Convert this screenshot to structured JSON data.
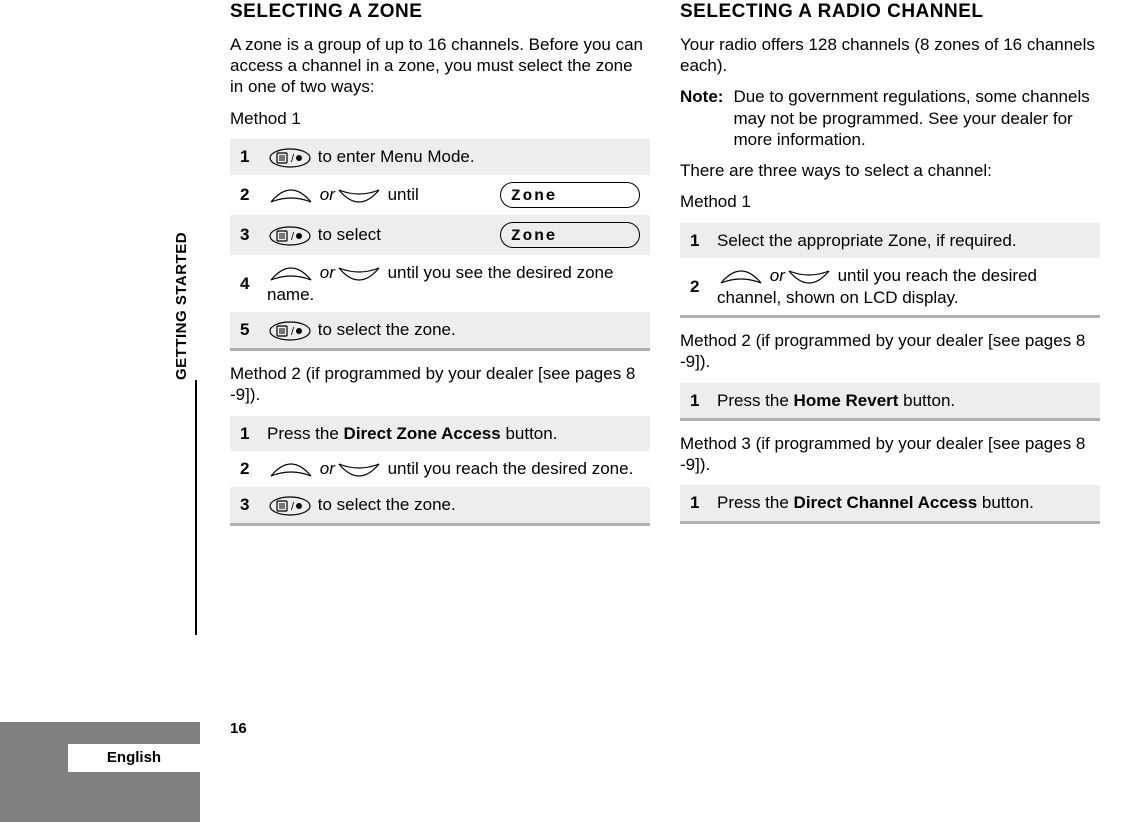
{
  "sidebar": {
    "tab_label": "English",
    "section_label": "GETTING STARTED"
  },
  "page_number": "16",
  "left": {
    "heading": "SELECTING A ZONE",
    "intro": "A zone is a group of up to 16 channels. Before you can access a channel in a zone, you must select the zone in one of two ways:",
    "method1_label": "Method 1",
    "method1": {
      "s1": " to enter Menu Mode.",
      "s2a": " ",
      "s2b": "or",
      "s2c": " until",
      "s2_pill": "Zone",
      "s3": " to select",
      "s3_pill": "Zone",
      "s4a": " ",
      "s4b": "or",
      "s4c": " until you see the desired zone name.",
      "s5": " to select the zone."
    },
    "method2_label": "Method 2 (if programmed by your dealer [see pages 8 -9]).",
    "method2": {
      "s1a": "Press the ",
      "s1b": "Direct Zone Access",
      "s1c": " button.",
      "s2a": " ",
      "s2b": "or",
      "s2c": " until you reach the desired zone.",
      "s3": " to select the zone."
    }
  },
  "right": {
    "heading": "SELECTING A RADIO CHANNEL",
    "intro": "Your radio offers 128 channels (8 zones of 16 channels each).",
    "note_label": "Note:",
    "note_text": "Due to government regulations, some channels may not be programmed. See your dealer for more information.",
    "ways_intro": "There are three ways to select a channel:",
    "method1_label": "Method 1",
    "method1": {
      "s1": "Select the appropriate Zone, if required.",
      "s2a": " ",
      "s2b": "or",
      "s2c": " until you reach the desired channel, shown on LCD display."
    },
    "method2_label": "Method 2 (if programmed by your dealer [see pages 8 -9]).",
    "method2": {
      "s1a": "Press the ",
      "s1b": "Home Revert",
      "s1c": " button."
    },
    "method3_label": "Method 3 (if programmed by your dealer [see pages 8 -9]).",
    "method3": {
      "s1a": "Press the ",
      "s1b": "Direct Channel Access",
      "s1c": " button."
    }
  }
}
